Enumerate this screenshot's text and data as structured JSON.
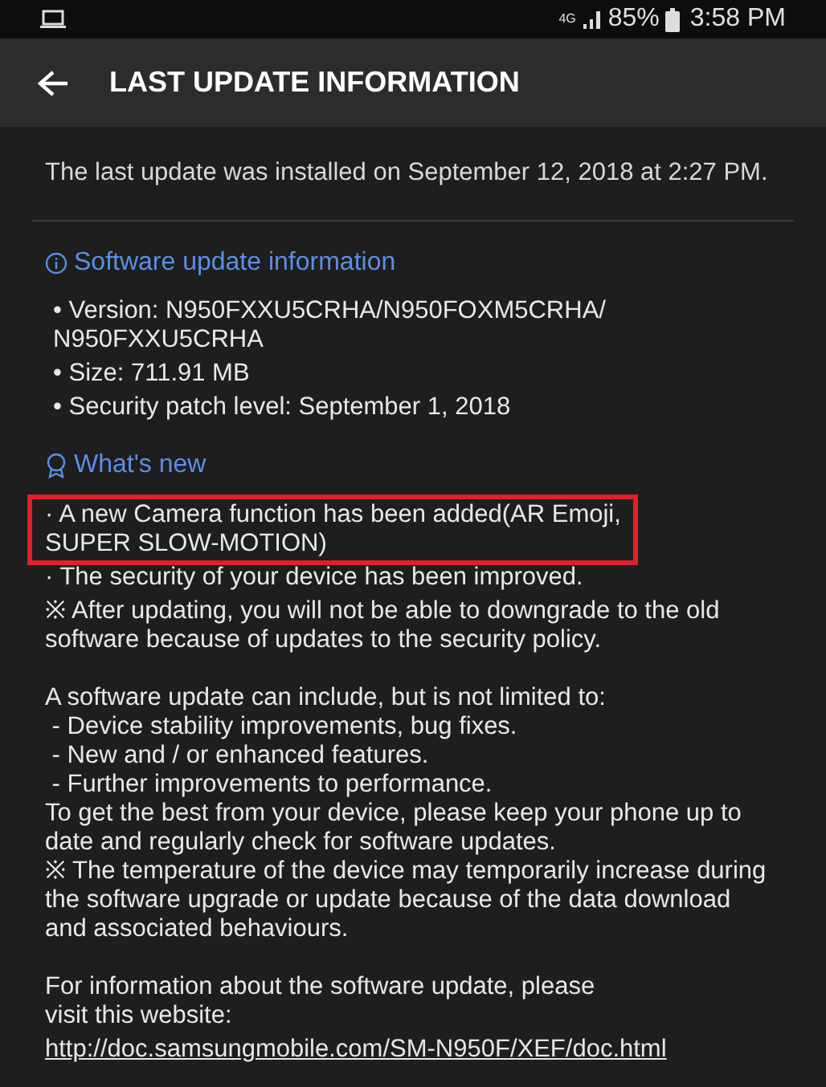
{
  "status_bar": {
    "network": "4G",
    "battery": "85%",
    "time": "3:58 PM"
  },
  "header": {
    "title": "LAST UPDATE INFORMATION"
  },
  "installed_note": "The last update was installed on September 12, 2018 at 2:27 PM.",
  "software_info": {
    "heading": "Software update information",
    "items": [
      {
        "lines": [
          "• Version: N950FXXU5CRHA/N950FOXM5CRHA/",
          "N950FXXU5CRHA"
        ]
      },
      {
        "lines": [
          "• Size: 711.91 MB"
        ]
      },
      {
        "lines": [
          "• Security patch level: September 1, 2018"
        ]
      }
    ]
  },
  "whats_new": {
    "heading": "What's new",
    "groups": [
      {
        "items": [
          {
            "kind": "text",
            "highlighted": true,
            "lines": [
              "· A new Camera function has been added(AR Emoji,",
              "SUPER SLOW-MOTION)"
            ]
          },
          {
            "kind": "text",
            "highlighted": false,
            "lines": [
              "· The security of your device has been improved."
            ]
          },
          {
            "kind": "text",
            "highlighted": false,
            "lines": [
              "※ After updating, you will not be able to downgrade to the old",
              "software because of updates to the security policy."
            ]
          }
        ]
      },
      {
        "items": [
          {
            "kind": "text",
            "highlighted": false,
            "lines": [
              "A software update can include, but is not limited to:",
              " - Device stability improvements, bug fixes.",
              " - New and / or enhanced features.",
              " - Further improvements to performance.",
              "To get the best from your device, please keep your phone up to",
              "date and regularly check for software updates.",
              "※ The temperature of the device may temporarily increase during",
              "the software upgrade or update because of the data download",
              "and associated behaviours."
            ]
          }
        ]
      },
      {
        "items": [
          {
            "kind": "text",
            "highlighted": false,
            "lines": [
              "For information about the software update, please",
              "visit this website:"
            ]
          },
          {
            "kind": "link",
            "highlighted": false,
            "lines": [
              "http://doc.samsungmobile.com/SM-N950F/XEF/doc.html"
            ]
          }
        ]
      }
    ]
  }
}
